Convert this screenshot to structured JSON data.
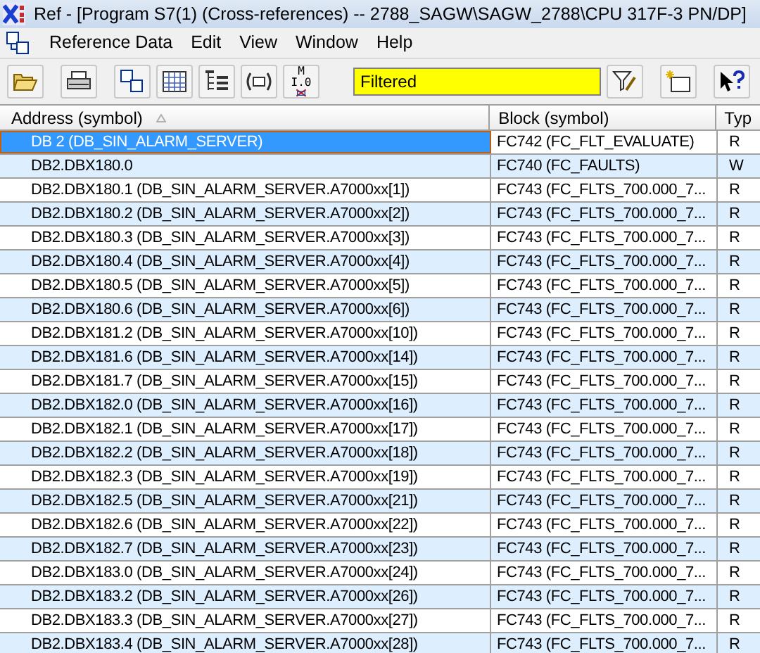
{
  "window": {
    "title": "Ref - [Program S7(1) (Cross-references) -- 2788_SAGW\\SAGW_2788\\CPU 317F-3 PN/DP]"
  },
  "menu": [
    "Reference Data",
    "Edit",
    "View",
    "Window",
    "Help"
  ],
  "toolbar": {
    "icon_label": "M I.0",
    "filter": {
      "value": "Filtered"
    }
  },
  "table": {
    "columns": [
      "Address (symbol)",
      "Block (symbol)",
      "Typ"
    ],
    "rows": [
      {
        "address": "DB 2 (DB_SIN_ALARM_SERVER)",
        "block": "FC742 (FC_FLT_EVALUATE)",
        "type": "R",
        "selected": true
      },
      {
        "address": "DB2.DBX180.0",
        "block": "FC740 (FC_FAULTS)",
        "type": "W",
        "selected": false
      },
      {
        "address": "DB2.DBX180.1 (DB_SIN_ALARM_SERVER.A7000xx[1])",
        "block": "FC743 (FC_FLTS_700.000_7...",
        "type": "R",
        "selected": false
      },
      {
        "address": "DB2.DBX180.2 (DB_SIN_ALARM_SERVER.A7000xx[2])",
        "block": "FC743 (FC_FLTS_700.000_7...",
        "type": "R",
        "selected": false
      },
      {
        "address": "DB2.DBX180.3 (DB_SIN_ALARM_SERVER.A7000xx[3])",
        "block": "FC743 (FC_FLTS_700.000_7...",
        "type": "R",
        "selected": false
      },
      {
        "address": "DB2.DBX180.4 (DB_SIN_ALARM_SERVER.A7000xx[4])",
        "block": "FC743 (FC_FLTS_700.000_7...",
        "type": "R",
        "selected": false
      },
      {
        "address": "DB2.DBX180.5 (DB_SIN_ALARM_SERVER.A7000xx[5])",
        "block": "FC743 (FC_FLTS_700.000_7...",
        "type": "R",
        "selected": false
      },
      {
        "address": "DB2.DBX180.6 (DB_SIN_ALARM_SERVER.A7000xx[6])",
        "block": "FC743 (FC_FLTS_700.000_7...",
        "type": "R",
        "selected": false
      },
      {
        "address": "DB2.DBX181.2 (DB_SIN_ALARM_SERVER.A7000xx[10])",
        "block": "FC743 (FC_FLTS_700.000_7...",
        "type": "R",
        "selected": false
      },
      {
        "address": "DB2.DBX181.6 (DB_SIN_ALARM_SERVER.A7000xx[14])",
        "block": "FC743 (FC_FLTS_700.000_7...",
        "type": "R",
        "selected": false
      },
      {
        "address": "DB2.DBX181.7 (DB_SIN_ALARM_SERVER.A7000xx[15])",
        "block": "FC743 (FC_FLTS_700.000_7...",
        "type": "R",
        "selected": false
      },
      {
        "address": "DB2.DBX182.0 (DB_SIN_ALARM_SERVER.A7000xx[16])",
        "block": "FC743 (FC_FLTS_700.000_7...",
        "type": "R",
        "selected": false
      },
      {
        "address": "DB2.DBX182.1 (DB_SIN_ALARM_SERVER.A7000xx[17])",
        "block": "FC743 (FC_FLTS_700.000_7...",
        "type": "R",
        "selected": false
      },
      {
        "address": "DB2.DBX182.2 (DB_SIN_ALARM_SERVER.A7000xx[18])",
        "block": "FC743 (FC_FLTS_700.000_7...",
        "type": "R",
        "selected": false
      },
      {
        "address": "DB2.DBX182.3 (DB_SIN_ALARM_SERVER.A7000xx[19])",
        "block": "FC743 (FC_FLTS_700.000_7...",
        "type": "R",
        "selected": false
      },
      {
        "address": "DB2.DBX182.5 (DB_SIN_ALARM_SERVER.A7000xx[21])",
        "block": "FC743 (FC_FLTS_700.000_7...",
        "type": "R",
        "selected": false
      },
      {
        "address": "DB2.DBX182.6 (DB_SIN_ALARM_SERVER.A7000xx[22])",
        "block": "FC743 (FC_FLTS_700.000_7...",
        "type": "R",
        "selected": false
      },
      {
        "address": "DB2.DBX182.7 (DB_SIN_ALARM_SERVER.A7000xx[23])",
        "block": "FC743 (FC_FLTS_700.000_7...",
        "type": "R",
        "selected": false
      },
      {
        "address": "DB2.DBX183.0 (DB_SIN_ALARM_SERVER.A7000xx[24])",
        "block": "FC743 (FC_FLTS_700.000_7...",
        "type": "R",
        "selected": false
      },
      {
        "address": "DB2.DBX183.2 (DB_SIN_ALARM_SERVER.A7000xx[26])",
        "block": "FC743 (FC_FLTS_700.000_7...",
        "type": "R",
        "selected": false
      },
      {
        "address": "DB2.DBX183.3 (DB_SIN_ALARM_SERVER.A7000xx[27])",
        "block": "FC743 (FC_FLTS_700.000_7...",
        "type": "R",
        "selected": false
      },
      {
        "address": "DB2.DBX183.4 (DB_SIN_ALARM_SERVER.A7000xx[28])",
        "block": "FC743 (FC_FLTS_700.000_7...",
        "type": "R",
        "selected": false
      }
    ]
  }
}
